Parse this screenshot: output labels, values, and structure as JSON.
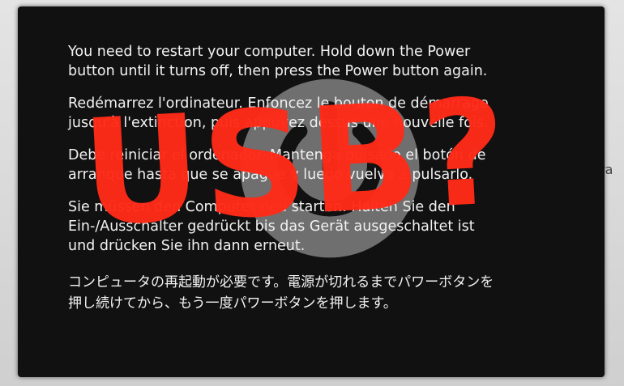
{
  "panic": {
    "messages": [
      "You need to restart your computer. Hold down the Power\nbutton until it turns off, then press the Power button again.",
      "Redémarrez l'ordinateur. Enfoncez le bouton de démarrage\njusqu'à l'extinction, puis appuyez dessus une nouvelle fois.",
      "Debe reiniciar el ordenador. Mantenga pulsado el botón de\narranque hasta que se apague y luego vuelva a pulsarlo.",
      "Sie müssen den Computer neu starten. Halten Sie den\nEin-/Ausschalter gedrückt bis das Gerät ausgeschaltet ist\nund drücken Sie ihn dann erneut.",
      "コンピュータの再起動が必要です。電源が切れるまでパワーボタンを\n押し続けてから、もう一度パワーボタンを押します。"
    ],
    "power_icon": "power-icon"
  },
  "overlay": {
    "text": "USB?",
    "color": "#ff2a18"
  },
  "background": {
    "edge_text": "ra"
  }
}
